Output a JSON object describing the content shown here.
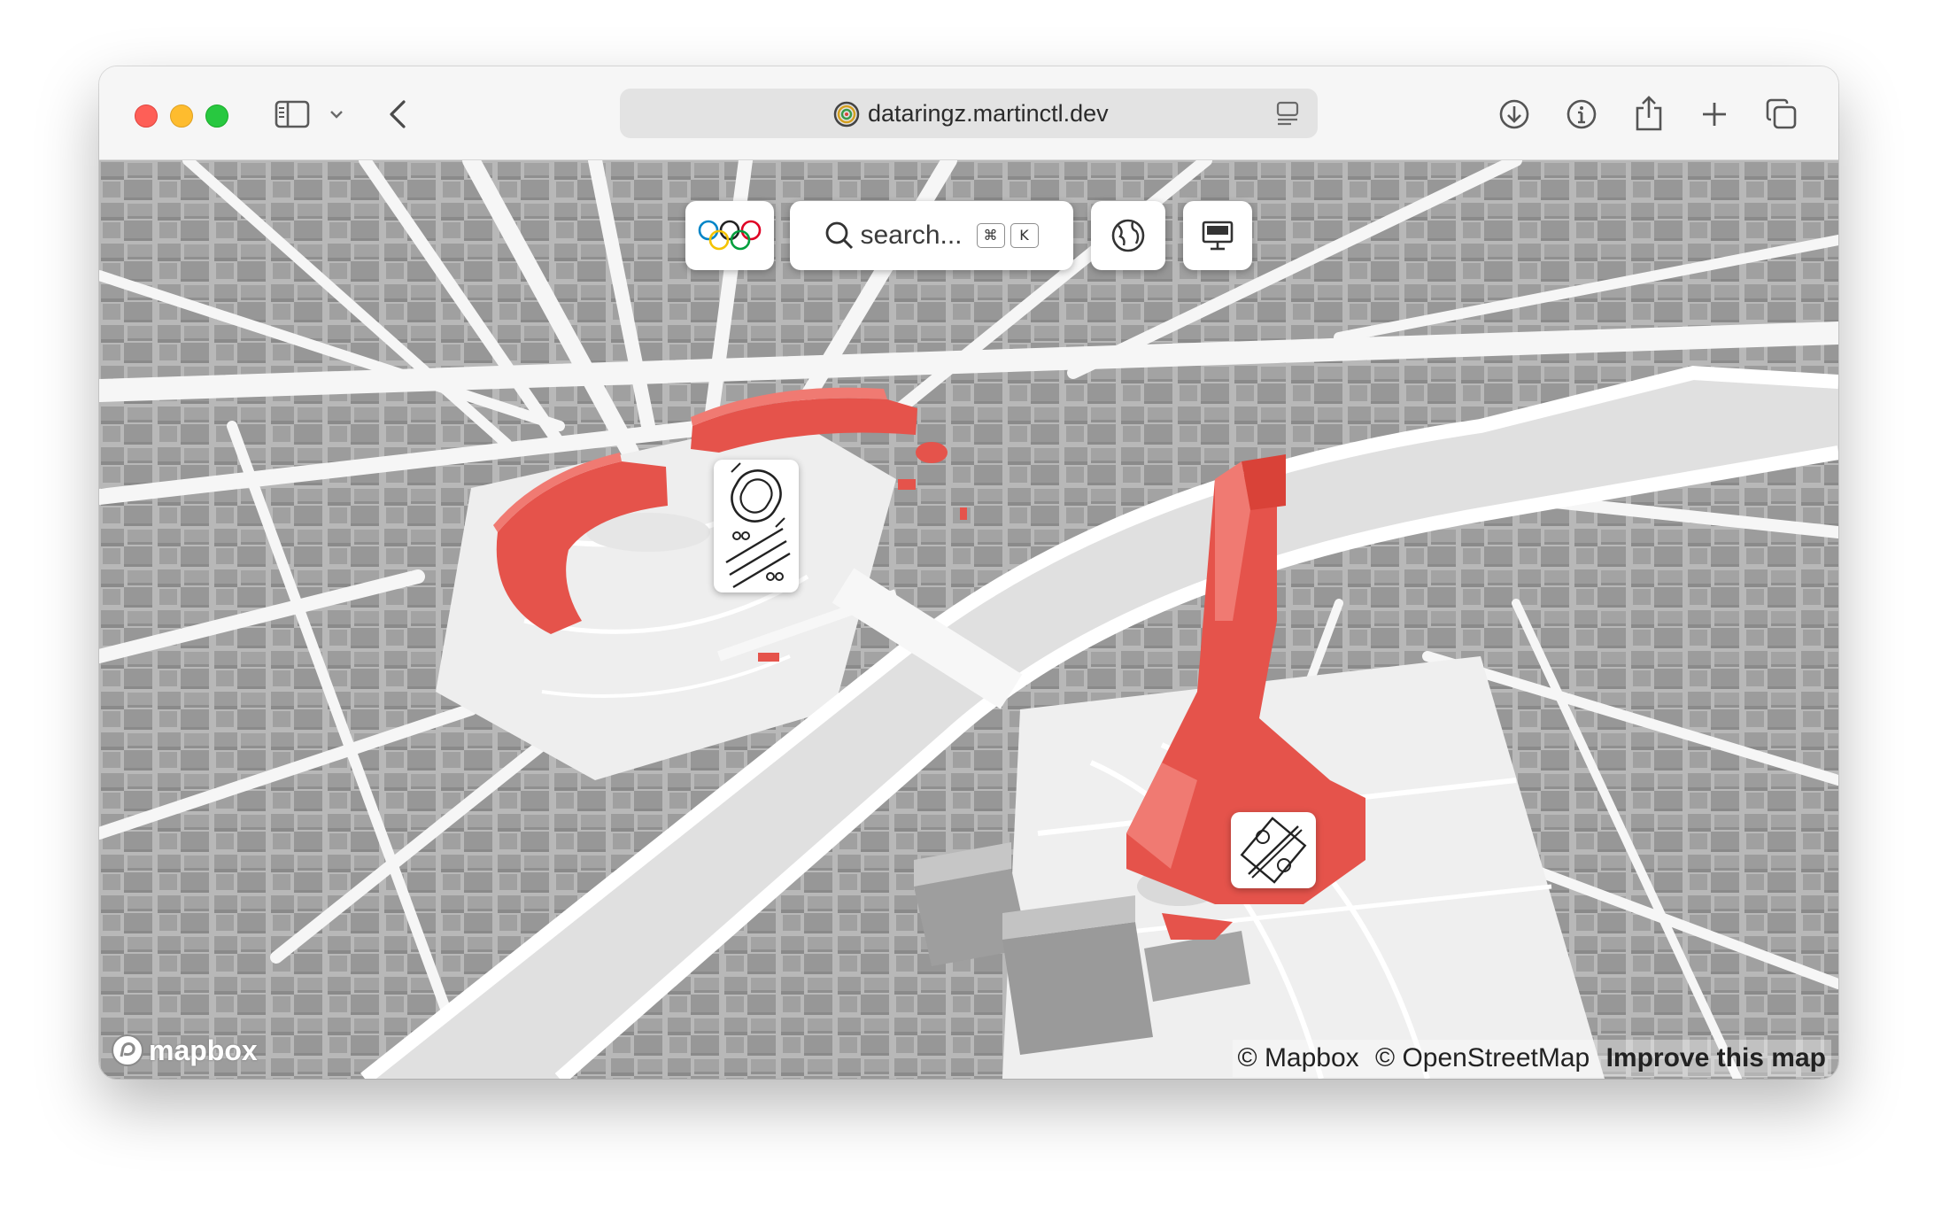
{
  "browser": {
    "url": "dataringz.martinctl.dev",
    "icons": [
      "sidebar-icon",
      "chevron-down-icon",
      "back-icon",
      "download-icon",
      "info-icon",
      "share-icon",
      "plus-icon",
      "tabs-icon",
      "reader-icon"
    ]
  },
  "map_ui": {
    "search_placeholder": "search...",
    "shortcut_cmd": "⌘",
    "shortcut_key": "K",
    "controls": [
      "olympic-rings-icon",
      "globe-icon",
      "monitor-icon"
    ]
  },
  "map": {
    "highlight_color": "#e5534b",
    "building_color": "#a8a8a8",
    "road_color": "#ffffff",
    "river_color": "#e3e3e3",
    "markers": [
      {
        "name": "athletics-cycling-venue",
        "icons": [
          "athletics-track-icon",
          "cycling-road-icon",
          "cycling-bmx-icon"
        ]
      },
      {
        "name": "beach-volleyball-venue",
        "icons": [
          "beach-volleyball-icon"
        ]
      }
    ]
  },
  "attribution": {
    "mapbox": "© Mapbox",
    "osm": "© OpenStreetMap",
    "improve": "Improve this map",
    "logo": "mapbox"
  }
}
